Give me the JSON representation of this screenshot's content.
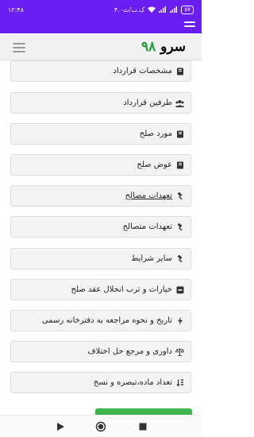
{
  "status": {
    "time": "۱۲:۴۸",
    "battery": "۵۷",
    "speed": "۴.۰ک.ب/ث"
  },
  "header": {
    "logo_text": "سرو",
    "logo_number": "۹۸"
  },
  "items": [
    {
      "label": "مشخصات قرارداد",
      "icon": "book-icon",
      "underline": false
    },
    {
      "label": "طرفین قرارداد",
      "icon": "users-icon",
      "underline": false
    },
    {
      "label": "مورد صلح",
      "icon": "book-icon",
      "underline": false
    },
    {
      "label": "عوض صلح",
      "icon": "book-icon",
      "underline": false
    },
    {
      "label": "تعهدات مصالح",
      "icon": "gavel-icon",
      "underline": true
    },
    {
      "label": "تعهدات متصالح",
      "icon": "gavel-icon",
      "underline": false
    },
    {
      "label": "سایر شرایط",
      "icon": "gavel-icon",
      "underline": false
    },
    {
      "label": "خیارات و ترب انحلال عقد صلح",
      "icon": "minus-square-icon",
      "underline": false
    },
    {
      "label": "تاریخ و نحوه مراجعه به دفترخانه رسمی",
      "icon": "bolt-icon",
      "underline": false
    },
    {
      "label": "داوری و مرجع حل اختلاف",
      "icon": "scale-icon",
      "underline": false
    },
    {
      "label": "تعداد ماده،تبصره و نسخ",
      "icon": "sort-icon",
      "underline": false
    }
  ],
  "colors": {
    "accent_purple": "#6a1ef0",
    "logo_green": "#1e9e3a",
    "button_green": "#3cb54a"
  }
}
